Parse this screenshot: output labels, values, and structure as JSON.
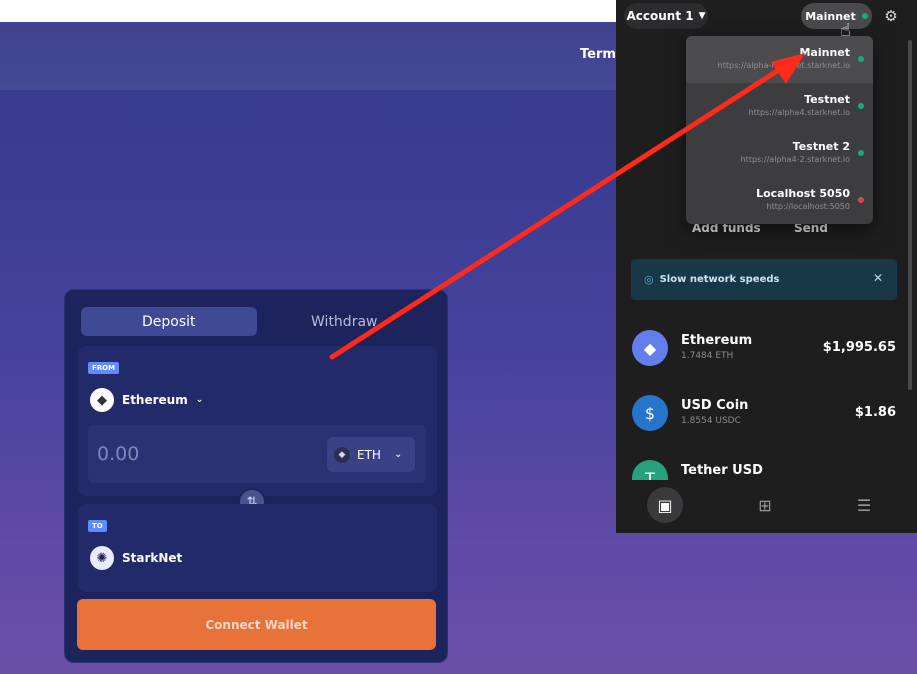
{
  "site": {
    "terms_label": "Terms"
  },
  "bridge": {
    "tabs": [
      {
        "label": "Deposit",
        "active": true
      },
      {
        "label": "Withdraw",
        "active": false
      }
    ],
    "from": {
      "tag": "FROM",
      "network": "Ethereum",
      "amount_placeholder": "0.00",
      "token": "ETH"
    },
    "to": {
      "tag": "TO",
      "network": "StarkNet"
    },
    "connect_label": "Connect Wallet"
  },
  "wallet": {
    "account_label": "Account 1",
    "current_network": "Mainnet",
    "networks": [
      {
        "name": "Mainnet",
        "url": "https://alpha-mainnet.starknet.io",
        "status": "green",
        "selected": true
      },
      {
        "name": "Testnet",
        "url": "https://alpha4.starknet.io",
        "status": "green",
        "selected": false
      },
      {
        "name": "Testnet 2",
        "url": "https://alpha4-2.starknet.io",
        "status": "green",
        "selected": false
      },
      {
        "name": "Localhost 5050",
        "url": "http://localhost:5050",
        "status": "red",
        "selected": false
      }
    ],
    "actions": {
      "add_funds": "Add funds",
      "send": "Send"
    },
    "banner": "Slow network speeds",
    "tokens": [
      {
        "name": "Ethereum",
        "balance": "1.7484 ETH",
        "usd": "$1,995.65"
      },
      {
        "name": "USD Coin",
        "balance": "1.8554 USDC",
        "usd": "$1.86"
      },
      {
        "name": "Tether USD",
        "balance": "",
        "usd": ""
      }
    ],
    "colors": {
      "ethereum": "#627eea",
      "usdc": "#2775ca",
      "tether": "#26a17b",
      "accent_orange": "#e8733a"
    }
  }
}
